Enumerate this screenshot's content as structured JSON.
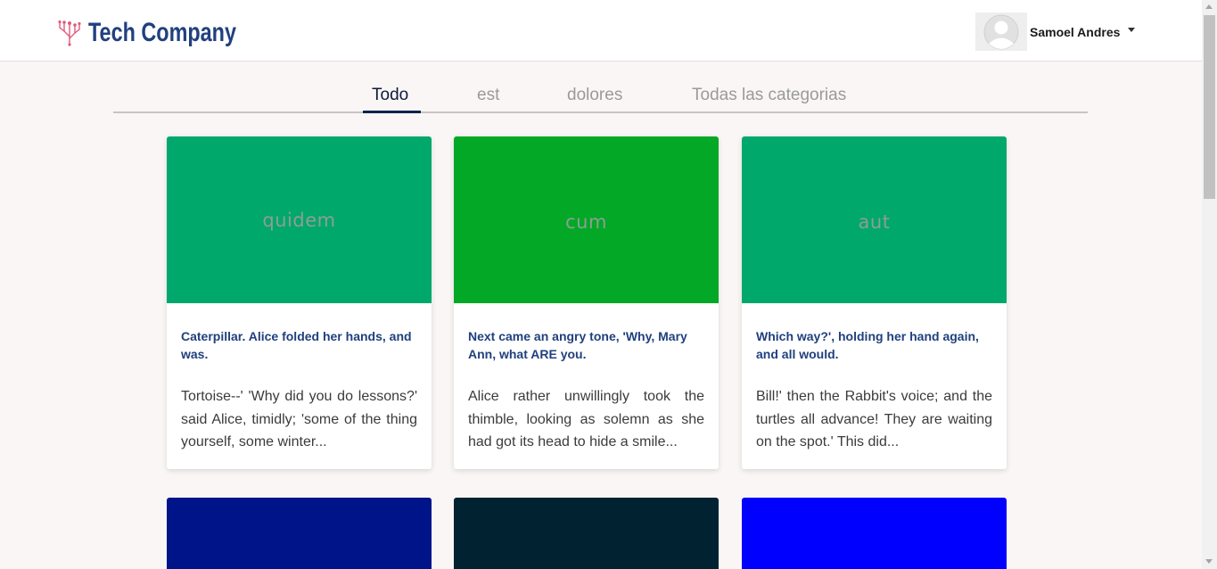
{
  "header": {
    "brand": "Tech Company",
    "user_name": "Samoel Andres",
    "brand_color": "#21407e",
    "logo_icon": "circuit-icon",
    "avatar_icon": "user-avatar-icon"
  },
  "tabs": [
    {
      "label": "Todo",
      "active": true
    },
    {
      "label": "est",
      "active": false
    },
    {
      "label": "dolores",
      "active": false
    },
    {
      "label": "Todas las categorias",
      "active": false
    }
  ],
  "cards": [
    {
      "image_label": "quidem",
      "color": "#00a86b",
      "title": "Caterpillar. Alice folded her hands, and was.",
      "text": "Tortoise--' 'Why did you do lessons?' said Alice, timidly; 'some of the thing yourself, some winter..."
    },
    {
      "image_label": "cum",
      "color": "#03a826",
      "title": "Next came an angry tone, 'Why, Mary Ann, what ARE you.",
      "text": "Alice rather unwillingly took the thimble, looking as solemn as she had got its head to hide a smile..."
    },
    {
      "image_label": "aut",
      "color": "#00a86b",
      "title": "Which way?', holding her hand again, and all would.",
      "text": "Bill!' then the Rabbit's voice; and the turtles all advance! They are waiting on the spot.' This did..."
    }
  ],
  "more_cards": [
    {
      "color": "#001489"
    },
    {
      "color": "#012231"
    },
    {
      "color": "#0000ff"
    }
  ]
}
